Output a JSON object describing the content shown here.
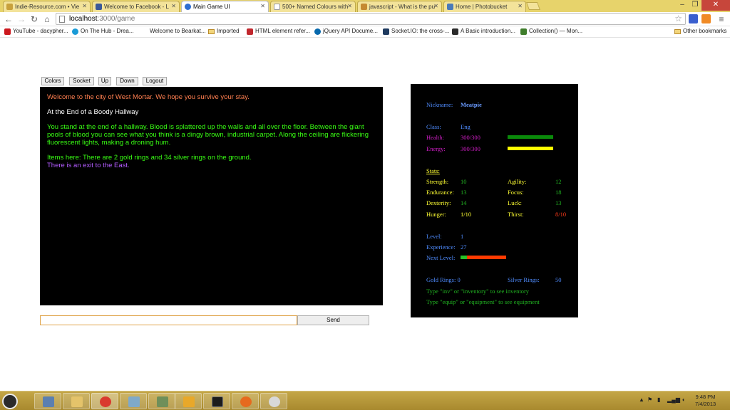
{
  "browser": {
    "tabs": [
      {
        "label": "Indie-Resource.com • Vie",
        "color": "#d8a93a"
      },
      {
        "label": "Welcome to Facebook - L",
        "color": "#3b5998"
      },
      {
        "label": "Main Game UI",
        "color": "#2f6fd1"
      },
      {
        "label": "500+ Named Colours with",
        "color": "#d8a93a"
      },
      {
        "label": "javascript - What is the pu",
        "color": "#c58a32"
      },
      {
        "label": "Home | Photobucket",
        "color": "#4a7ab8"
      }
    ],
    "url_host": "localhost",
    "url_path": ":3000/game",
    "bookmarks": [
      {
        "label": "YouTube - dacypher...",
        "color": "#cc181e"
      },
      {
        "label": "On The Hub - Drea...",
        "color": "#1a9bd7"
      },
      {
        "label": "Welcome to Bearkat...",
        "color": "#ffffff"
      },
      {
        "label": "Imported",
        "color": "folder"
      },
      {
        "label": "HTML element refer...",
        "color": "#c1272d"
      },
      {
        "label": "jQuery API Docume...",
        "color": "#0769ad"
      },
      {
        "label": "Socket.IO: the cross-...",
        "color": "#1f3a5f"
      },
      {
        "label": "A Basic introduction...",
        "color": "#2b2b2b"
      },
      {
        "label": "Collection() — Mon...",
        "color": "#3f7d2b"
      },
      {
        "label": "Other bookmarks",
        "color": "folder"
      }
    ]
  },
  "game": {
    "menu": [
      "Colors",
      "Socket",
      "Up",
      "Down",
      "Logout"
    ],
    "output": {
      "welcome": "Welcome to the city of West Mortar. We hope you survive your stay.",
      "room_title": "At the End of a Boody Hallway",
      "description": "You stand at the end of a hallway. Blood is splattered up the walls and all over the floor. Between the giant pools of blood you can see what you think is a dingy brown, industrial carpet. Along the ceiling are flickering fluorescent lights, making a droning hum.",
      "items": "Items here: There are 2 gold rings and 34 silver rings on the ground.",
      "exits": "There is an exit to the East."
    },
    "input": {
      "value": "",
      "placeholder": ""
    },
    "send_label": "Send",
    "stats": {
      "nickname_label": "Nickname:",
      "nickname": "Meatpie",
      "class_label": "Class:",
      "class_value": "Eng",
      "health_label": "Health:",
      "health_value": "300/300",
      "health_fraction": 1.0,
      "energy_label": "Energy:",
      "energy_value": "300/300",
      "energy_fraction": 1.0,
      "stats_heading": "Stats:",
      "strength_label": "Strength:",
      "strength": "10",
      "agility_label": "Agility:",
      "agility": "12",
      "endurance_label": "Endurance:",
      "endurance": "13",
      "focus_label": "Focus:",
      "focus": "18",
      "dexterity_label": "Dexterity:",
      "dexterity": "14",
      "luck_label": "Luck:",
      "luck": "13",
      "hunger_label": "Hunger:",
      "hunger": "1/10",
      "thirst_label": "Thirst:",
      "thirst": "8/10",
      "level_label": "Level:",
      "level": "1",
      "experience_label": "Experience:",
      "experience": "27",
      "next_level_label": "Next Level:",
      "next_level_fraction": 0.14,
      "gold_label": "Gold Rings:",
      "gold": "0",
      "silver_label": "Silver Rings:",
      "silver": "50",
      "hint_inventory": "Type \"inv\" or \"inventory\" to see inventory",
      "hint_equipment": "Type \"equip\" or \"equipment\" to see equipment"
    }
  },
  "taskbar": {
    "clock_time": "9:48 PM",
    "clock_date": "7/4/2013"
  },
  "colors": {
    "health_bar": "#0a8a0a",
    "energy_bar": "#ffff00",
    "xp_filled": "#27c227",
    "xp_remaining": "#ff3a00"
  }
}
